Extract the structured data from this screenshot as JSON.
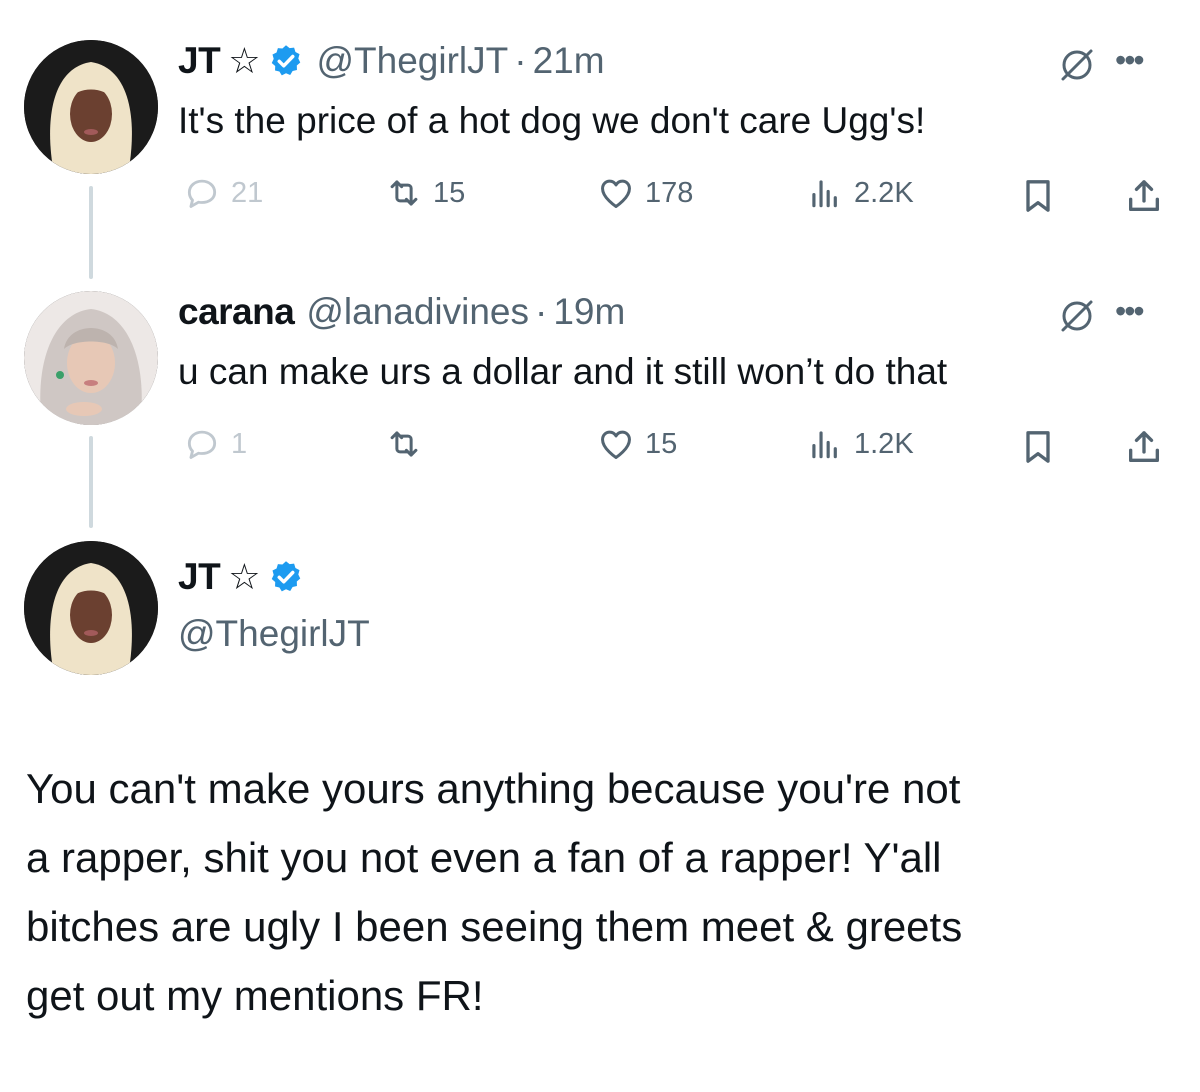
{
  "tweets": [
    {
      "name": "JT",
      "star": "☆",
      "verified": true,
      "handle": "@ThegirlJT",
      "separator": "·",
      "time": "21m",
      "text": "It's the price of a hot dog we don't care Ugg's!",
      "replies": "21",
      "retweets": "15",
      "likes": "178",
      "views": "2.2K"
    },
    {
      "name": "carana",
      "handle": "@lanadivines",
      "separator": "·",
      "time": "19m",
      "text": "u can make urs a dollar and it still won’t do that",
      "replies": "1",
      "retweets": "",
      "likes": "15",
      "views": "1.2K"
    }
  ],
  "main_tweet": {
    "name": "JT",
    "star": "☆",
    "verified": true,
    "handle": "@ThegirlJT",
    "lines": [
      "You can't make yours anything because you're not",
      "a rapper, shit you not even a fan of a rapper! Y'all",
      "bitches are ugly I been seeing them meet & greets",
      "get out my mentions FR!"
    ]
  },
  "colors": {
    "text": "#0f1419",
    "secondary": "#536471",
    "verified": "#1d9bf0",
    "thread_line": "#cfd9de"
  },
  "icons": [
    "reply-icon",
    "retweet-icon",
    "like-icon",
    "views-icon",
    "bookmark-icon",
    "share-icon",
    "grok-icon",
    "more-icon",
    "verified-icon",
    "star-icon"
  ]
}
